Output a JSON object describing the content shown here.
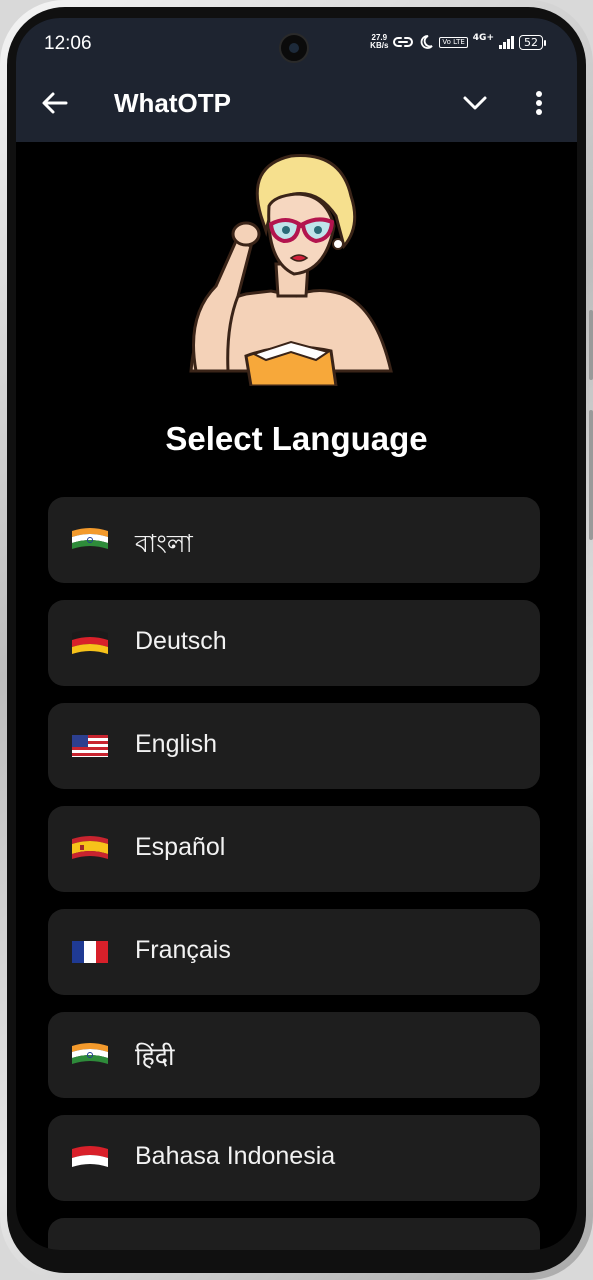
{
  "status_bar": {
    "time": "12:06",
    "net_speed_value": "27.9",
    "net_speed_unit": "KB/s",
    "volte": "Vo LTE",
    "network_type": "4G+",
    "battery": "52"
  },
  "app_bar": {
    "title": "WhatOTP",
    "back_icon": "arrow-left-icon",
    "dropdown_icon": "chevron-down-icon",
    "menu_icon": "more-vertical-icon"
  },
  "heading": "Select Language",
  "languages": [
    {
      "label": "বাংলা",
      "flag": "india-flag-icon"
    },
    {
      "label": "Deutsch",
      "flag": "germany-flag-icon"
    },
    {
      "label": "English",
      "flag": "usa-flag-icon"
    },
    {
      "label": "Español",
      "flag": "spain-flag-icon"
    },
    {
      "label": "Français",
      "flag": "france-flag-icon"
    },
    {
      "label": "हिंदी",
      "flag": "india-flag-icon"
    },
    {
      "label": "Bahasa Indonesia",
      "flag": "indonesia-flag-icon"
    }
  ],
  "colors": {
    "app_bar_bg": "#1e2430",
    "screen_bg": "#000000",
    "list_item_bg": "#1e1e1e",
    "text": "#ffffff"
  }
}
